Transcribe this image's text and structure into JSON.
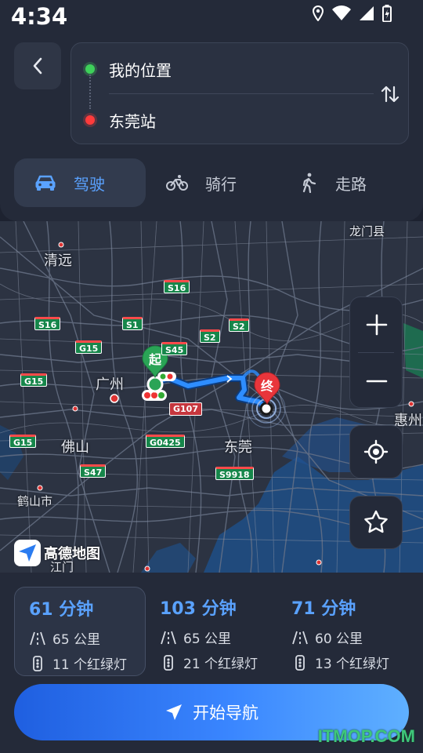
{
  "status_bar": {
    "time": "4:34",
    "icons": [
      "location-icon",
      "wifi-icon",
      "signal-icon",
      "battery-icon"
    ]
  },
  "route": {
    "origin": "我的位置",
    "destination": "东莞站",
    "origin_color": "#3ed05a",
    "destination_color": "#ff3b3b"
  },
  "modes": [
    {
      "label": "驾驶",
      "icon": "car-icon",
      "active": true
    },
    {
      "label": "骑行",
      "icon": "bicycle-icon",
      "active": false
    },
    {
      "label": "走路",
      "icon": "walk-icon",
      "active": false
    }
  ],
  "map": {
    "cities": {
      "qingyuan": "清远",
      "longmen": "龙门县",
      "guangzhou": "广州",
      "foshan": "佛山",
      "dongguan": "东莞",
      "huizhou": "惠州",
      "heshan": "鹤山市",
      "jiangmen": "江门"
    },
    "roads": {
      "s16a": "S16",
      "s16b": "S16",
      "s1": "S1",
      "s2a": "S2",
      "s2b": "S2",
      "g15a": "G15",
      "g15b": "G15",
      "g15c": "G15",
      "s45": "S45",
      "g107": "G107",
      "g0425": "G0425",
      "s47": "S47",
      "s9918": "S9918"
    },
    "start_label": "起",
    "end_label": "终",
    "brand": "高德地图",
    "route_color": "#2e8dff",
    "start_color": "#2aa456",
    "end_color": "#e8353b"
  },
  "plans": [
    {
      "time": "61 分钟",
      "distance": "65 公里",
      "lights": "11 个红绿灯",
      "active": true
    },
    {
      "time": "103 分钟",
      "distance": "65 公里",
      "lights": "21 个红绿灯",
      "active": false
    },
    {
      "time": "71 分钟",
      "distance": "60 公里",
      "lights": "13 个红绿灯",
      "active": false
    }
  ],
  "navigate_label": "开始导航",
  "watermark": "ITMOP.COM"
}
